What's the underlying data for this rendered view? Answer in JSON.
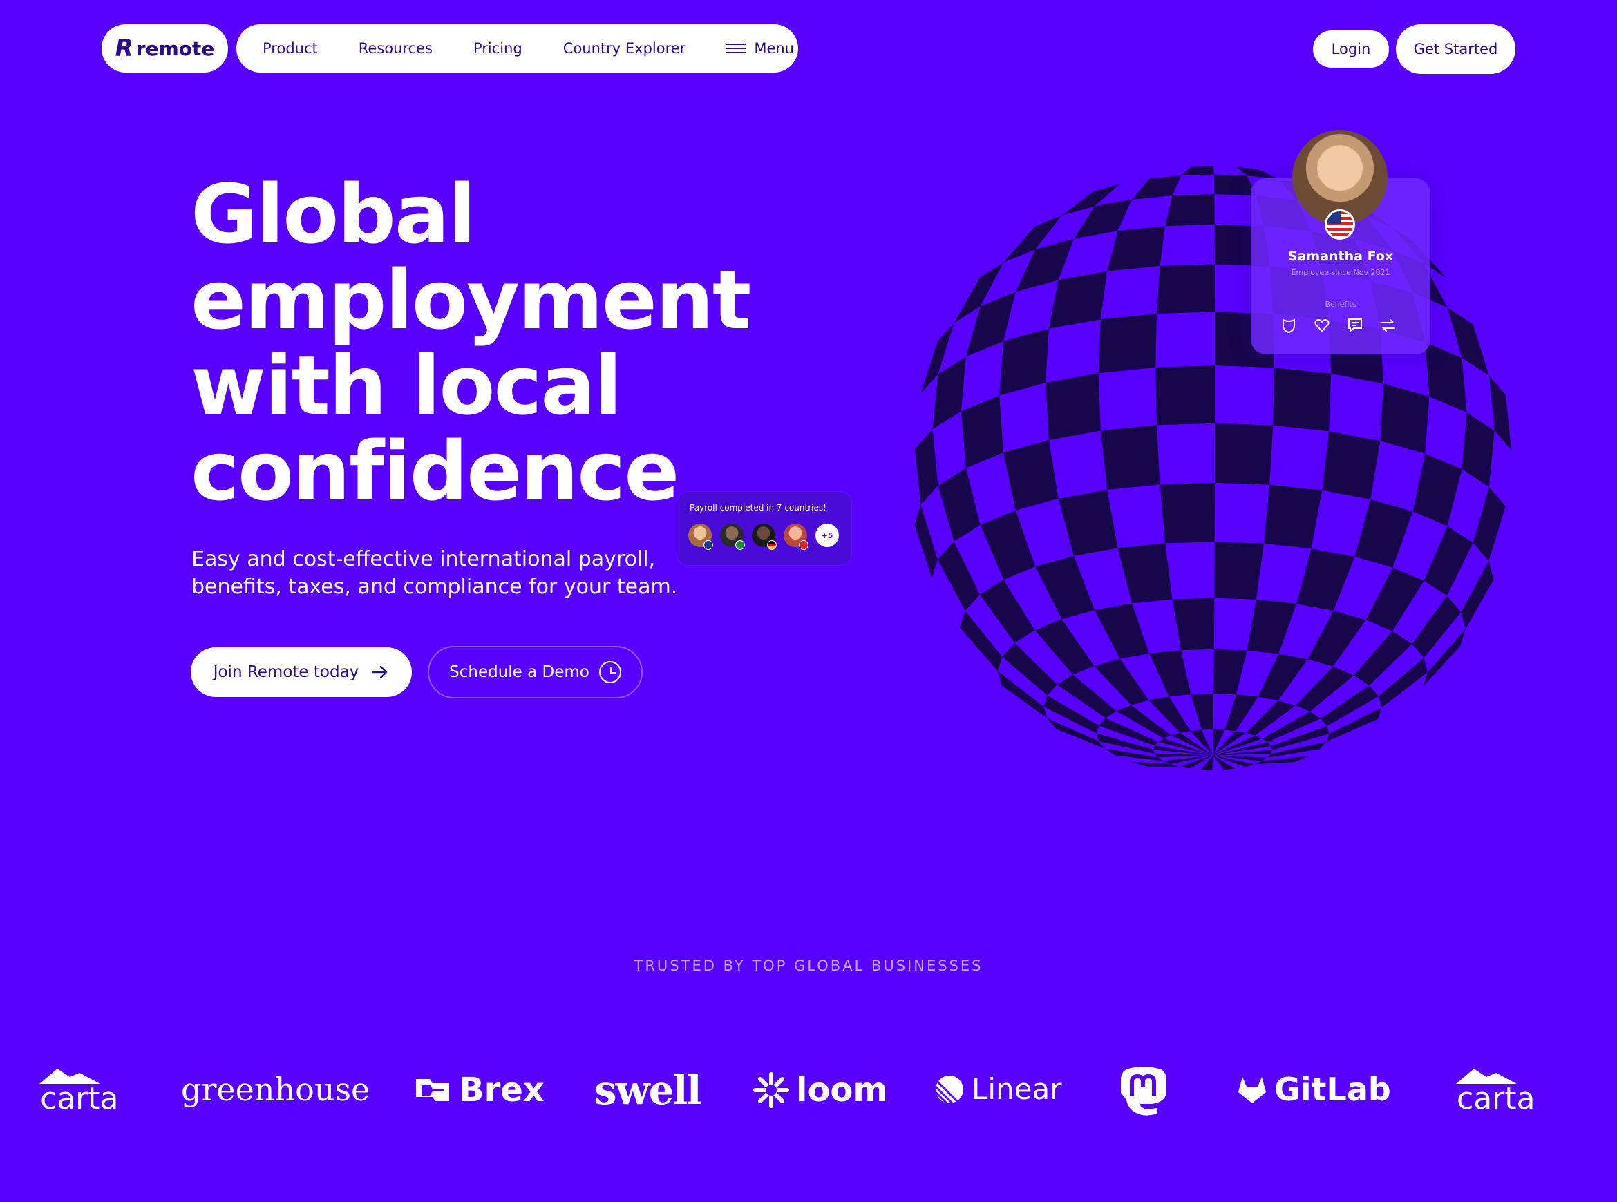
{
  "nav": {
    "logo_text": "remote",
    "links": [
      "Product",
      "Resources",
      "Pricing",
      "Country Explorer"
    ],
    "menu_label": "Menu",
    "login_label": "Login",
    "get_started_label": "Get Started"
  },
  "hero": {
    "title_lines": [
      "Global",
      "employment",
      "with local",
      "confidence"
    ],
    "subtitle_lines": [
      "Easy and cost-effective international payroll,",
      "benefits, taxes, and compliance for your team."
    ],
    "cta_primary": "Join Remote today",
    "cta_secondary": "Schedule a Demo"
  },
  "payroll_card": {
    "text": "Payroll completed in 7 countries!",
    "more_count": "+5"
  },
  "profile_card": {
    "name": "Samantha Fox",
    "since": "Employee since Nov 2021",
    "benefits_label": "Benefits"
  },
  "trusted": {
    "heading": "TRUSTED BY TOP GLOBAL BUSINESSES",
    "logos": [
      "carta",
      "greenhouse",
      "Brex",
      "swell",
      "loom",
      "Linear",
      "GitLab",
      "carta"
    ]
  },
  "colors": {
    "background": "#5800ff",
    "text_dark": "#2c0a8a",
    "globe_dark": "#17064a"
  }
}
